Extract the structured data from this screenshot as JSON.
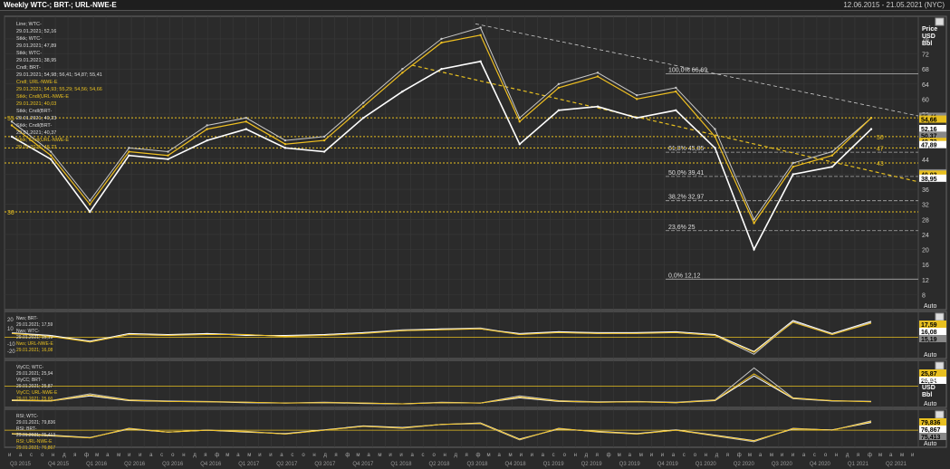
{
  "window": {
    "title": "Weekly WTC-; BRT-; URL-NWE-E",
    "date_range": "12.06.2015 - 21.05.2021 (NYC)"
  },
  "panels": {
    "price": {
      "legend": [
        "Line; WTC-",
        "29.01.2021; 52,16",
        "Stkk; WTC-",
        "29.01.2021; 47,89",
        "Stkk; WTC-",
        "29.01.2021; 38,95",
        "Cndl; BRT-",
        "29.01.2021; 54,98; 56,41; 54,87; 55,41",
        "Cndl; URL-NWE-E",
        "29.01.2021; 54,93; 55,29; 54,56; 54,66",
        "Stkk; Cndl(URL-NWE-E",
        "29.01.2021; 40,03",
        "Stkk; Cndl(BRT-",
        "29.01.2021; 40,23",
        "Stkk; Cndl(BRT-",
        "29.01.2021; 40,37",
        "Stkk; Cndl(URL-NWE-E",
        "29.01.2021; 48,73"
      ],
      "axis_title": [
        "Price",
        "USD",
        "Bbl"
      ],
      "ticks": [
        "76",
        "72",
        "68",
        "64",
        "60",
        "56",
        "52",
        "48",
        "44",
        "40",
        "36",
        "32",
        "28",
        "24",
        "20",
        "16",
        "12",
        "8"
      ],
      "value_tags": [
        "55,41",
        "54,66",
        "52,16",
        "50,37",
        "48,73",
        "47,89",
        "40,37",
        "40,03",
        "38,95"
      ],
      "fib_levels": [
        {
          "label": "100,0%  66,69"
        },
        {
          "label": "61,8%   45,85"
        },
        {
          "label": "50,0%   39,41"
        },
        {
          "label": "38,2%   32,97"
        },
        {
          "label": "23,6%   25"
        },
        {
          "label": "0,0%    12,12"
        }
      ],
      "hline_labels": [
        "50",
        "47",
        "43",
        "30",
        "55"
      ],
      "auto": "Auto"
    },
    "spread": {
      "legend": [
        "Nws; BRT-",
        "29.01.2021; 17,59",
        "Nws; WTC-",
        "29.01.2021; 15,19",
        "Nws; URL-NWE-E",
        "29.01.2021; 16,08"
      ],
      "ticks": [
        "20",
        "10",
        "-10",
        "-20"
      ],
      "value_tags": [
        "17,59",
        "16,08",
        "15,19"
      ],
      "auto": "Auto"
    },
    "volatility": {
      "legend": [
        "VlyCC; WTC-",
        "29.01.2021; 25,94",
        "VlyCC; BRT-",
        "29.01.2021; 25,87",
        "VlyCC; URL-NWE-E",
        "29.01.2021; 25,60"
      ],
      "axis_title": [
        "Value",
        "USD",
        "Bbl"
      ],
      "value_tags": [
        "25,87",
        "25,94"
      ],
      "auto": "Auto"
    },
    "rsi": {
      "legend": [
        "RSI; WTC-",
        "29.01.2021; 79,836",
        "RSI; BRT-",
        "29.01.2021; 75,413",
        "RSI; URL-NWE-E",
        "29.01.2021; 76,867"
      ],
      "value_tags": [
        "79,836",
        "76,867",
        "75,413"
      ],
      "auto": "Auto"
    }
  },
  "x_axis": {
    "months": [
      "и",
      "а",
      "с",
      "о",
      "н",
      "д",
      "я",
      "ф",
      "м",
      "а",
      "м",
      "и",
      "и",
      "а",
      "с",
      "о",
      "н",
      "д",
      "я",
      "ф",
      "м",
      "а",
      "м",
      "и",
      "и",
      "а",
      "с",
      "о",
      "н",
      "д",
      "я",
      "ф",
      "м",
      "а",
      "м",
      "и",
      "и",
      "а",
      "с",
      "о",
      "н",
      "д",
      "я",
      "ф",
      "м",
      "а",
      "м",
      "и",
      "и",
      "а",
      "с",
      "о",
      "н",
      "д",
      "я",
      "ф",
      "м",
      "а",
      "м",
      "и",
      "и",
      "а",
      "с",
      "о",
      "н",
      "д",
      "я",
      "ф",
      "м",
      "а",
      "м",
      "и",
      "и",
      "а",
      "с",
      "о",
      "н",
      "д",
      "я",
      "ф",
      "м",
      "а",
      "м",
      "и"
    ],
    "quarters": [
      "Q3 2015",
      "Q4 2015",
      "Q1 2016",
      "Q2 2016",
      "Q3 2016",
      "Q4 2016",
      "Q1 2017",
      "Q2 2017",
      "Q3 2017",
      "Q4 2017",
      "Q1 2018",
      "Q2 2018",
      "Q3 2018",
      "Q4 2018",
      "Q1 2019",
      "Q2 2019",
      "Q3 2019",
      "Q4 2019",
      "Q1 2020",
      "Q2 2020",
      "Q3 2020",
      "Q4 2020",
      "Q1 2021",
      "Q2 2021"
    ]
  },
  "chart_data": {
    "type": "line",
    "title": "Weekly WTC-; BRT-; URL-NWE-E",
    "ylabel": "Price USD Bbl",
    "ylim": [
      4,
      82
    ],
    "x": [
      "2015-Q3",
      "2015-Q4",
      "2016-Q1",
      "2016-Q2",
      "2016-Q3",
      "2016-Q4",
      "2017-Q1",
      "2017-Q2",
      "2017-Q3",
      "2017-Q4",
      "2018-Q1",
      "2018-Q2",
      "2018-Q3",
      "2018-Q4",
      "2019-Q1",
      "2019-Q2",
      "2019-Q3",
      "2019-Q4",
      "2020-Q1",
      "2020-Q2",
      "2020-Q3",
      "2020-Q4",
      "2021-Q1"
    ],
    "series": [
      {
        "name": "WTC-",
        "values": [
          50,
          44,
          30,
          45,
          44,
          49,
          52,
          47,
          46,
          55,
          62,
          68,
          70,
          48,
          57,
          58,
          55,
          57,
          47,
          20,
          40,
          42,
          52
        ]
      },
      {
        "name": "BRT-",
        "values": [
          54,
          46,
          33,
          47,
          46,
          53,
          55,
          49,
          50,
          59,
          68,
          76,
          79,
          55,
          64,
          67,
          61,
          63,
          52,
          28,
          43,
          46,
          55
        ]
      },
      {
        "name": "URL-NWE-E",
        "values": [
          53,
          45,
          32,
          46,
          45,
          52,
          54,
          48,
          49,
          58,
          67,
          75,
          77,
          54,
          63,
          66,
          60,
          62,
          50,
          27,
          42,
          45,
          55
        ]
      }
    ],
    "colors": {
      "wtc": "#ffffff",
      "brt": "#c8c8c8",
      "urals": "#f0c020",
      "axis_tag": "#f0c020"
    }
  }
}
